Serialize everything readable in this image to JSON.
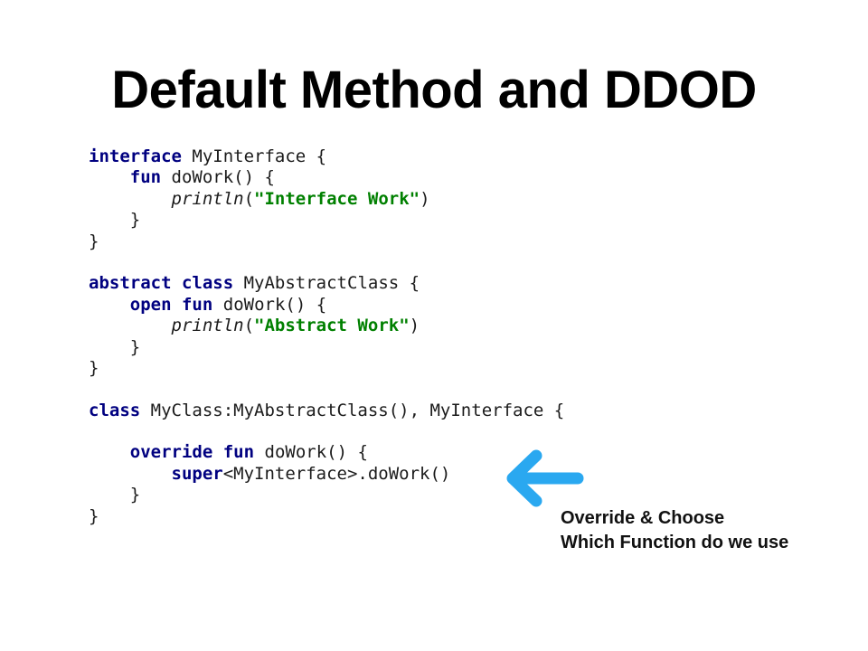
{
  "slide": {
    "title": "Default Method and DDOD",
    "accent_color": "#2aa8f0"
  },
  "code": {
    "lines": [
      [
        {
          "t": "interface",
          "k": "kw"
        },
        {
          "t": " MyInterface {",
          "k": "plain"
        }
      ],
      [
        {
          "t": "    ",
          "k": "plain"
        },
        {
          "t": "fun",
          "k": "kw"
        },
        {
          "t": " doWork() {",
          "k": "plain"
        }
      ],
      [
        {
          "t": "        ",
          "k": "plain"
        },
        {
          "t": "println",
          "k": "fn"
        },
        {
          "t": "(",
          "k": "plain"
        },
        {
          "t": "\"Interface Work\"",
          "k": "str"
        },
        {
          "t": ")",
          "k": "plain"
        }
      ],
      [
        {
          "t": "    }",
          "k": "plain"
        }
      ],
      [
        {
          "t": "}",
          "k": "plain"
        }
      ],
      [],
      [
        {
          "t": "abstract",
          "k": "kw"
        },
        {
          "t": " ",
          "k": "plain"
        },
        {
          "t": "class",
          "k": "kw"
        },
        {
          "t": " MyAbstractClass {",
          "k": "plain"
        }
      ],
      [
        {
          "t": "    ",
          "k": "plain"
        },
        {
          "t": "open",
          "k": "kw"
        },
        {
          "t": " ",
          "k": "plain"
        },
        {
          "t": "fun",
          "k": "kw"
        },
        {
          "t": " doWork() {",
          "k": "plain"
        }
      ],
      [
        {
          "t": "        ",
          "k": "plain"
        },
        {
          "t": "println",
          "k": "fn"
        },
        {
          "t": "(",
          "k": "plain"
        },
        {
          "t": "\"Abstract Work\"",
          "k": "str"
        },
        {
          "t": ")",
          "k": "plain"
        }
      ],
      [
        {
          "t": "    }",
          "k": "plain"
        }
      ],
      [
        {
          "t": "}",
          "k": "plain"
        }
      ],
      [],
      [
        {
          "t": "class",
          "k": "kw"
        },
        {
          "t": " MyClass:MyAbstractClass(), MyInterface {",
          "k": "plain"
        }
      ],
      [],
      [
        {
          "t": "    ",
          "k": "plain"
        },
        {
          "t": "override",
          "k": "kw"
        },
        {
          "t": " ",
          "k": "plain"
        },
        {
          "t": "fun",
          "k": "kw"
        },
        {
          "t": " doWork() {",
          "k": "plain"
        }
      ],
      [
        {
          "t": "        ",
          "k": "plain"
        },
        {
          "t": "super",
          "k": "kw"
        },
        {
          "t": "<MyInterface>.doWork()",
          "k": "plain"
        }
      ],
      [
        {
          "t": "    }",
          "k": "plain"
        }
      ],
      [
        {
          "t": "}",
          "k": "plain"
        }
      ]
    ]
  },
  "annotation": {
    "line1": "Override & Choose",
    "line2": "Which Function do we use",
    "icon": "arrow-left-icon"
  }
}
